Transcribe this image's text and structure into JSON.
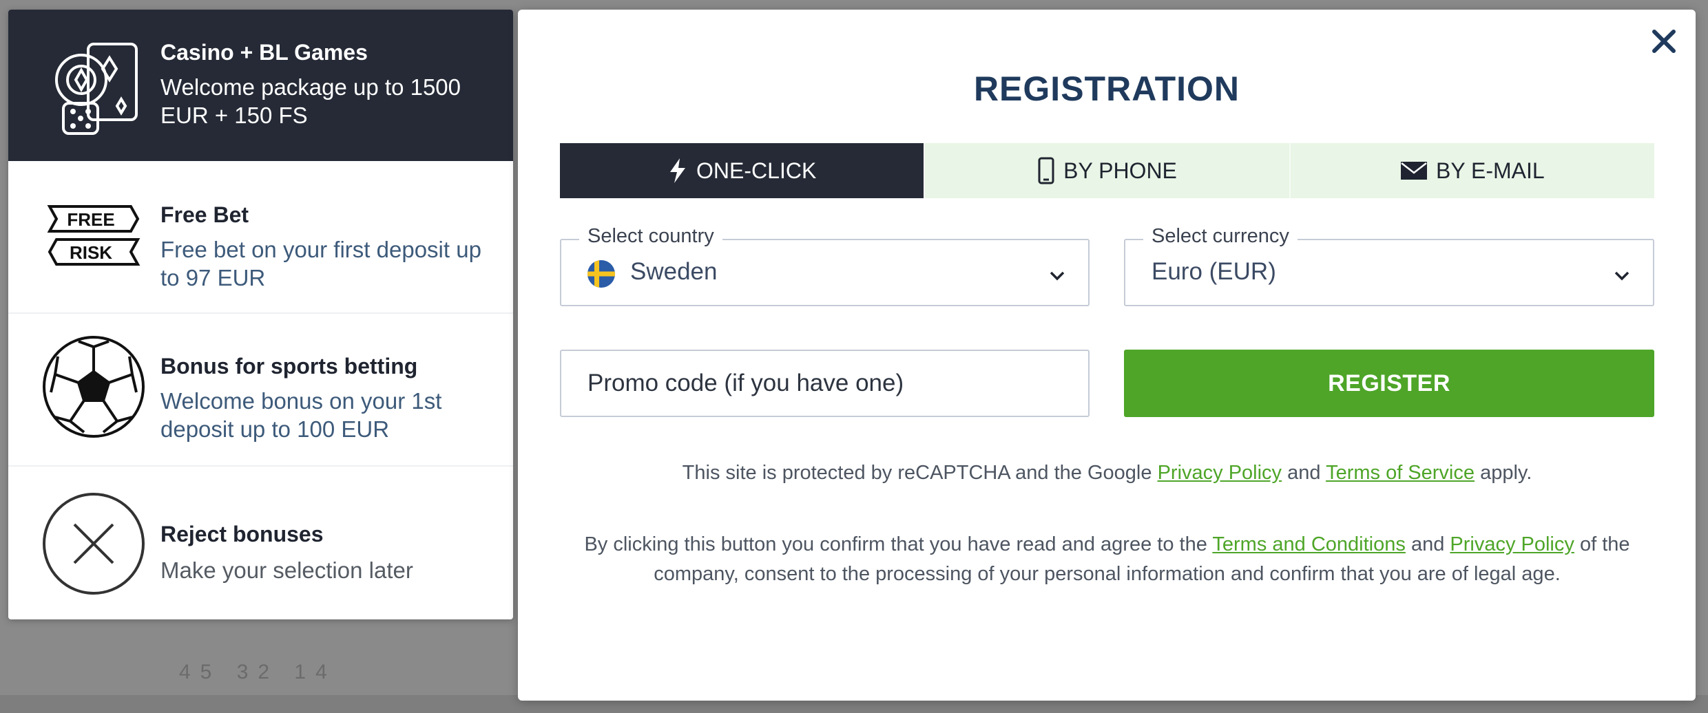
{
  "background": {
    "ghost_text": "45  32  14"
  },
  "bonuses": [
    {
      "icon": "casino-chips-cards-dice-icon",
      "title": "Casino + BL Games",
      "description": "Welcome package up to 1500 EUR + 150 FS",
      "selected": true
    },
    {
      "icon": "free-risk-icon",
      "icon_text_top": "FREE",
      "icon_text_bottom": "RISK",
      "title": "Free Bet",
      "description": "Free bet on your first deposit up to 97 EUR",
      "selected": false
    },
    {
      "icon": "soccer-ball-icon",
      "title": "Bonus for sports betting",
      "description": "Welcome bonus on your 1st deposit up to 100 EUR",
      "selected": false
    },
    {
      "icon": "reject-x-icon",
      "title": "Reject bonuses",
      "description": "Make your selection later",
      "selected": false
    }
  ],
  "registration": {
    "title": "REGISTRATION",
    "close_icon": "close-icon",
    "tabs": [
      {
        "label": "ONE-CLICK",
        "icon": "lightning-icon",
        "active": true
      },
      {
        "label": "BY PHONE",
        "icon": "phone-icon",
        "active": false
      },
      {
        "label": "BY E-MAIL",
        "icon": "envelope-icon",
        "active": false
      }
    ],
    "country": {
      "legend": "Select country",
      "value": "Sweden",
      "flag_icon": "sweden-flag-icon"
    },
    "currency": {
      "legend": "Select currency",
      "value": "Euro (EUR)"
    },
    "promo": {
      "placeholder": "Promo code (if you have one)"
    },
    "register_label": "REGISTER",
    "recaptcha": {
      "prefix": "This site is protected by reCAPTCHA and the Google",
      "privacy_link": "Privacy Policy",
      "and": "and",
      "terms_link": "Terms of Service",
      "suffix": "apply."
    },
    "consent": {
      "prefix": "By clicking this button you confirm that you have read and agree to the",
      "terms_link": "Terms and Conditions",
      "and": "and",
      "privacy_link": "Privacy Policy",
      "suffix": "of the company, consent to the processing of your personal information and confirm that you are of legal age."
    }
  },
  "colors": {
    "dark": "#252a36",
    "accent_green": "#4ea528",
    "tab_bg": "#e9f5e6",
    "title_blue": "#1f3a5c"
  }
}
